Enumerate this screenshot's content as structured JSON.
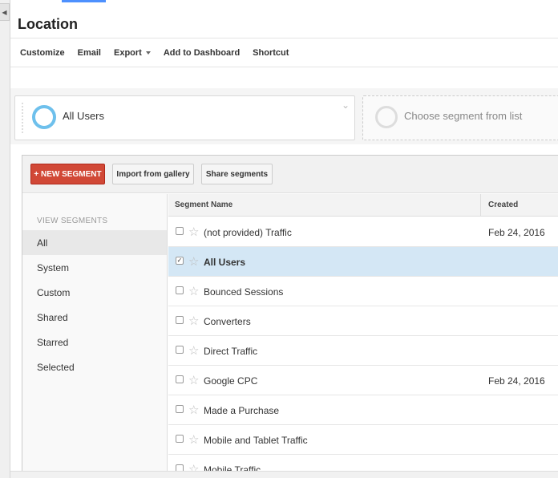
{
  "page": {
    "title": "Location"
  },
  "toolbar": {
    "customize": "Customize",
    "email": "Email",
    "export": "Export",
    "add_to_dashboard": "Add to Dashboard",
    "shortcut": "Shortcut"
  },
  "segments": {
    "active_label": "All Users",
    "empty_label": "Choose segment from list"
  },
  "panel": {
    "new_segment": "+ NEW SEGMENT",
    "import_gallery": "Import from gallery",
    "share_segments": "Share segments"
  },
  "sidebar": {
    "heading": "VIEW SEGMENTS",
    "items": [
      {
        "label": "All"
      },
      {
        "label": "System"
      },
      {
        "label": "Custom"
      },
      {
        "label": "Shared"
      },
      {
        "label": "Starred"
      },
      {
        "label": "Selected"
      }
    ]
  },
  "table": {
    "columns": [
      "Segment Name",
      "Created"
    ],
    "rows": [
      {
        "name": "(not provided) Traffic",
        "created": "Feb 24, 2016",
        "checked": false
      },
      {
        "name": "All Users",
        "created": "",
        "checked": true
      },
      {
        "name": "Bounced Sessions",
        "created": "",
        "checked": false
      },
      {
        "name": "Converters",
        "created": "",
        "checked": false
      },
      {
        "name": "Direct Traffic",
        "created": "",
        "checked": false
      },
      {
        "name": "Google CPC",
        "created": "Feb 24, 2016",
        "checked": false
      },
      {
        "name": "Made a Purchase",
        "created": "",
        "checked": false
      },
      {
        "name": "Mobile and Tablet Traffic",
        "created": "",
        "checked": false
      },
      {
        "name": "Mobile Traffic",
        "created": "",
        "checked": false
      }
    ]
  },
  "colors": {
    "accent_blue": "#4d90fe",
    "segment_ring": "#6ec0ec",
    "new_segment_red": "#d14836",
    "selected_row": "#d4e7f5"
  },
  "icons": {
    "rail_toggle": "chevron-left-icon",
    "segment_expand": "chevron-down-icon",
    "row_star": "star-outline-icon",
    "export_caret": "caret-down-icon"
  }
}
